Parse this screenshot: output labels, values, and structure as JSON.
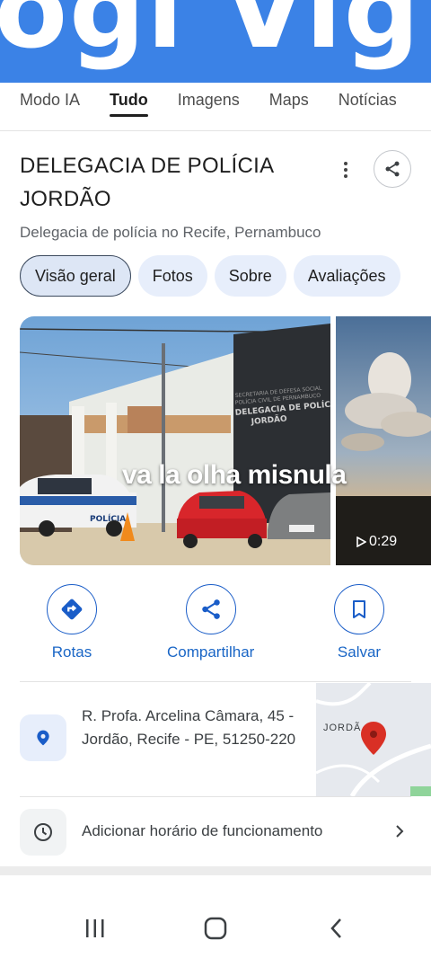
{
  "banner": {
    "text": "ogl Vig"
  },
  "tabs": [
    {
      "label": "Modo IA",
      "active": false
    },
    {
      "label": "Tudo",
      "active": true
    },
    {
      "label": "Imagens",
      "active": false
    },
    {
      "label": "Maps",
      "active": false
    },
    {
      "label": "Notícias",
      "active": false
    }
  ],
  "place": {
    "title": "DELEGACIA DE POLÍCIA JORDÃO",
    "subtitle": "Delegacia de polícia no Recife, Pernambuco"
  },
  "chips": [
    {
      "label": "Visão geral",
      "active": true
    },
    {
      "label": "Fotos",
      "active": false
    },
    {
      "label": "Sobre",
      "active": false
    },
    {
      "label": "Avaliações",
      "active": false
    }
  ],
  "media": {
    "caption": "va la olha misnula",
    "duration": "0:29",
    "building_sign": "SECRETARIA DE DEFESA SOCIAL POLÍCIA CIVIL DE PERNAMBUCO DELEGACIA DE POLÍCIA JORDÃO",
    "car_text": "POLÍCIA"
  },
  "actions": [
    {
      "label": "Rotas",
      "icon": "directions-icon"
    },
    {
      "label": "Compartilhar",
      "icon": "share-icon"
    },
    {
      "label": "Salvar",
      "icon": "bookmark-icon"
    }
  ],
  "address": {
    "text": "R. Profa. Arcelina Câmara, 45 - Jordão, Recife - PE, 51250-220",
    "map_label": "JORDÃ"
  },
  "hours": {
    "text": "Adicionar horário de funcionamento"
  },
  "colors": {
    "accent": "#1a66c6",
    "banner": "#3b82e6",
    "chip_bg": "#e7eefb",
    "pin": "#d93025"
  }
}
